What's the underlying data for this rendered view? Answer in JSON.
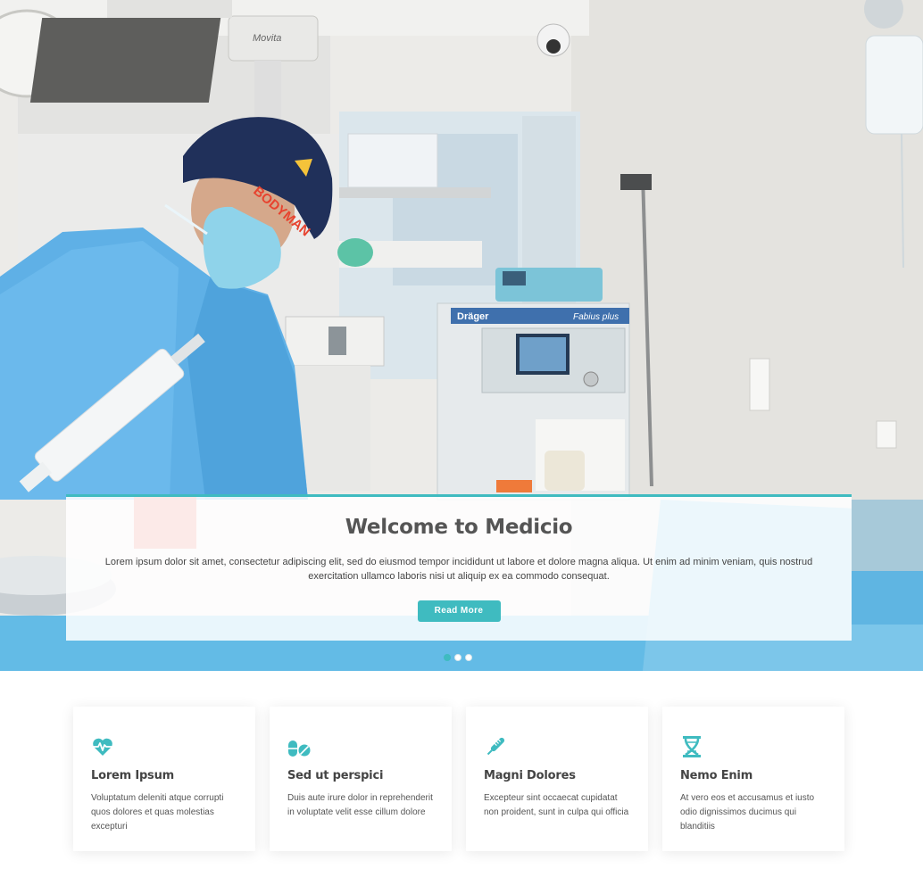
{
  "hero": {
    "title": "Welcome to Medicio",
    "description": "Lorem ipsum dolor sit amet, consectetur adipiscing elit, sed do eiusmod tempor incididunt ut labore et dolore magna aliqua. Ut enim ad minim veniam, quis nostrud exercitation ullamco laboris nisi ut aliquip ex ea commodo consequat.",
    "button_label": "Read More",
    "background": "operating-room-photo",
    "slides_total": 3,
    "active_slide": 1,
    "equipment_labels": {
      "lamp_brand": "Movita",
      "machine_brand": "Dräger",
      "machine_model": "Fabius plus",
      "cap_text": "BODYMAN"
    }
  },
  "services": [
    {
      "icon": "heart-pulse-icon",
      "title": "Lorem Ipsum",
      "text": "Voluptatum deleniti atque corrupti quos dolores et quas molestias excepturi"
    },
    {
      "icon": "pills-icon",
      "title": "Sed ut perspici",
      "text": "Duis aute irure dolor in reprehenderit in voluptate velit esse cillum dolore"
    },
    {
      "icon": "thermometer-icon",
      "title": "Magni Dolores",
      "text": "Excepteur sint occaecat cupidatat non proident, sunt in culpa qui officia"
    },
    {
      "icon": "dna-icon",
      "title": "Nemo Enim",
      "text": "At vero eos et accusamus et iusto odio dignissimos ducimus qui blanditiis"
    }
  ],
  "colors": {
    "accent": "#3fbbc0",
    "heading": "#555555",
    "text": "#444444",
    "scrub_blue": "#5fb0e6"
  }
}
